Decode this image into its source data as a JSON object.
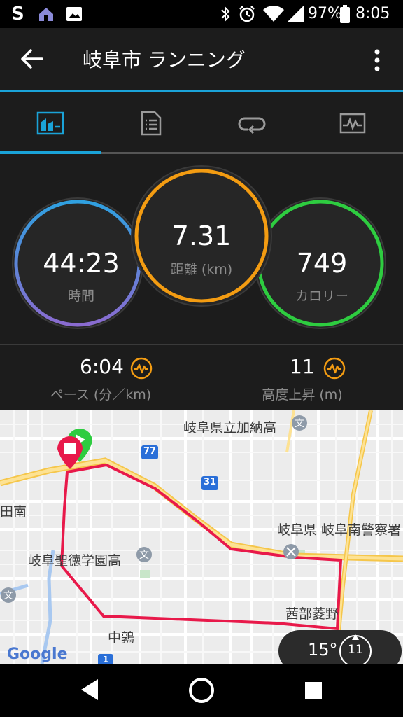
{
  "status_bar": {
    "battery": "97%",
    "time": "8:05",
    "icons": [
      "s-logo-icon",
      "home-notify-icon",
      "image-icon",
      "bluetooth-icon",
      "alarm-icon",
      "wifi-icon",
      "signal-icon",
      "battery-icon"
    ]
  },
  "app_bar": {
    "title": "岐阜市 ランニング",
    "back_icon": "arrow-left-icon",
    "menu_icon": "more-vert-icon"
  },
  "tabs": [
    {
      "name": "summary",
      "icon": "chart-summary-icon",
      "active": true
    },
    {
      "name": "details",
      "icon": "document-list-icon",
      "active": false
    },
    {
      "name": "laps",
      "icon": "loop-icon",
      "active": false
    },
    {
      "name": "graphs",
      "icon": "waveform-icon",
      "active": false
    }
  ],
  "metrics": {
    "time": {
      "value": "44:23",
      "label": "時間"
    },
    "distance": {
      "value": "7.31",
      "label": "距離 (km)"
    },
    "calories": {
      "value": "749",
      "label": "カロリー"
    }
  },
  "stats": {
    "pace": {
      "value": "6:04",
      "label": "ペース (分／km)"
    },
    "elevation": {
      "value": "11",
      "label": "高度上昇 (m)"
    }
  },
  "map": {
    "labels": {
      "school1": "岐阜県立加納高",
      "police": "岐阜県 岐阜南警察署",
      "school2": "岐阜聖徳学園高",
      "area1": "茜部菱野",
      "area2": "中鶉",
      "area3": "田南",
      "route77": "77",
      "route31": "31",
      "route1": "1"
    },
    "google": "Google",
    "temperature": "15°",
    "wind": "11"
  },
  "colors": {
    "accent_blue": "#1aa3d8",
    "orange": "#f39c12",
    "green": "#2ecc40",
    "route_red": "#e8194a"
  }
}
